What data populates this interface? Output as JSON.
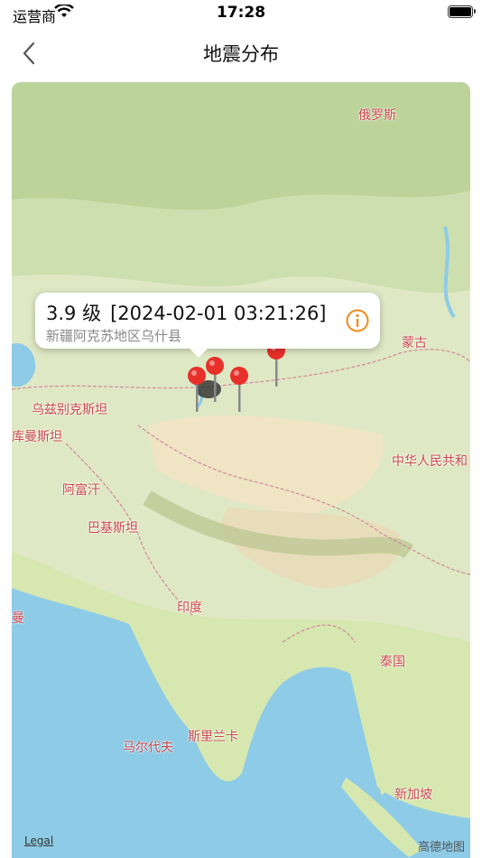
{
  "status_bar": {
    "carrier": "运营商",
    "time": "17:28"
  },
  "nav": {
    "title": "地震分布"
  },
  "map": {
    "labels": {
      "russia": "俄罗斯",
      "mongolia": "蒙古",
      "uzbekistan": "乌兹别克斯坦",
      "turkmenistan": "库曼斯坦",
      "china": "中华人民共和",
      "afghanistan": "阿富汗",
      "pakistan": "巴基斯坦",
      "india": "印度",
      "thailand": "泰国",
      "srilanka": "斯里兰卡",
      "maldives": "马尔代夫",
      "singapore": "新加坡",
      "left_edge": "曼"
    },
    "legal": "Legal",
    "brand": "高德地图"
  },
  "callout": {
    "magnitude": "3.9 级",
    "time": "[2024-02-01 03:21:26]",
    "location": "新疆阿克苏地区乌什县"
  },
  "colors": {
    "pin": "#e8302b",
    "label": "#c9484c",
    "accent": "#f08c1a"
  }
}
